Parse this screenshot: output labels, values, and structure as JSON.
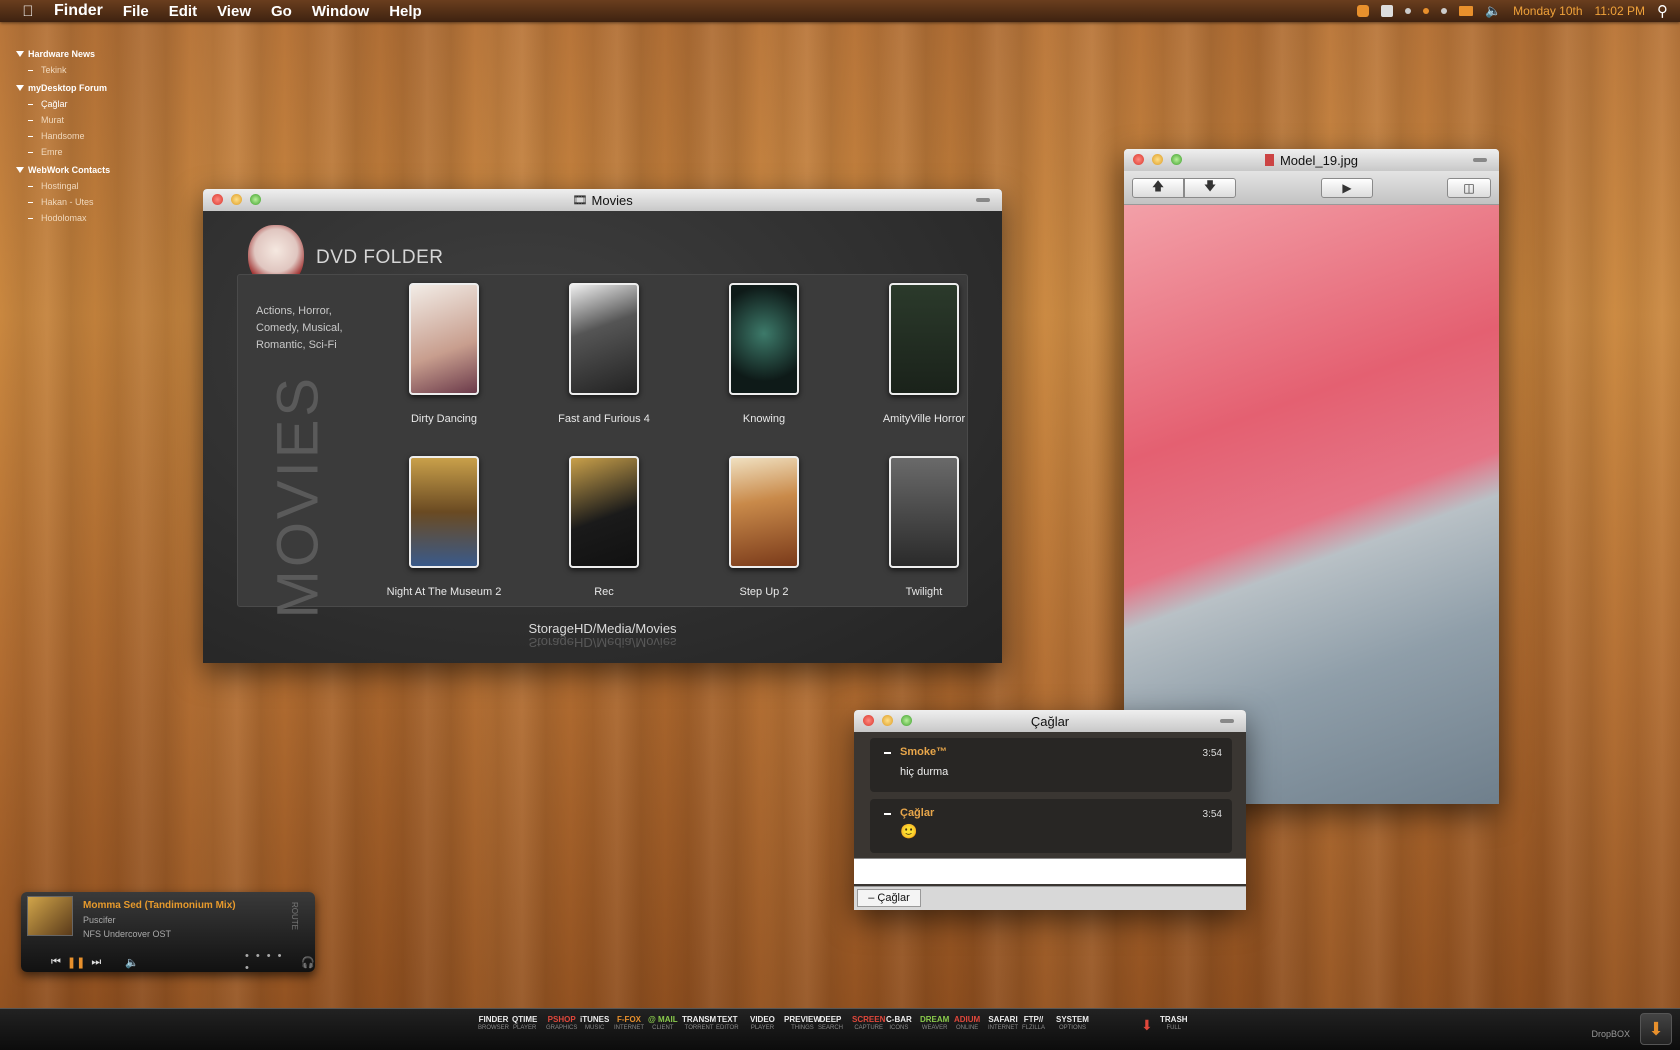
{
  "menubar": {
    "app": "Finder",
    "menus": [
      "File",
      "Edit",
      "View",
      "Go",
      "Window",
      "Help"
    ],
    "day": "Monday 10th",
    "time": "11:02 PM"
  },
  "sidebar": {
    "groups": [
      {
        "label": "Hardware News",
        "items": [
          "Tekink"
        ]
      },
      {
        "label": "myDesktop Forum",
        "items": [
          "Çağlar",
          "Murat",
          "Handsome",
          "Emre"
        ]
      },
      {
        "label": "WebWork Contacts",
        "items": [
          "Hostingal",
          "Hakan - Utes",
          "Hodolomax"
        ]
      }
    ]
  },
  "movies": {
    "title": "Movies",
    "header": "DVD FOLDER",
    "genres": "Actions, Horror, Comedy, Musical, Romantic, Sci-Fi",
    "side_word": "MOVIES",
    "path": "StorageHD/Media/Movies",
    "items": [
      {
        "title": "Dirty Dancing",
        "color": "#d9c7b8"
      },
      {
        "title": "Fast and Furious 4",
        "color": "#5a5a5a"
      },
      {
        "title": "Knowing",
        "color": "#234a3f"
      },
      {
        "title": "AmityVille Horror",
        "color": "#3d4a3a"
      },
      {
        "title": "Night At The Museum 2",
        "color": "#8a6a2a"
      },
      {
        "title": "Rec",
        "color": "#3a3020"
      },
      {
        "title": "Step Up 2",
        "color": "#b3743a"
      },
      {
        "title": "Twilight",
        "color": "#4a4a4a"
      }
    ]
  },
  "preview": {
    "title": "Model_19.jpg"
  },
  "chat": {
    "title": "Çağlar",
    "messages": [
      {
        "sender": "Smoke™",
        "time": "3:54",
        "text": "hiç durma"
      },
      {
        "sender": "Çağlar",
        "time": "3:54",
        "text": "🙂"
      }
    ],
    "tab": "– Çağlar"
  },
  "music": {
    "track": "Momma Sed (Tandimonium Mix)",
    "artist": "Puscifer",
    "album": "NFS Undercover OST",
    "route_label": "ROUTE"
  },
  "dock": {
    "items": [
      {
        "label": "FINDER",
        "sub": "BROWSER",
        "color": "white"
      },
      {
        "label": "QTIME",
        "sub": "PLAYER",
        "color": "white"
      },
      {
        "label": "PSHOP",
        "sub": "GRAPHICS",
        "color": "red"
      },
      {
        "label": "iTUNES",
        "sub": "MUSIC",
        "color": "white"
      },
      {
        "label": "F-FOX",
        "sub": "INTERNET",
        "color": "orange"
      },
      {
        "label": "@ MAIL",
        "sub": "CLIENT",
        "color": "green"
      },
      {
        "label": "TRANSM",
        "sub": "TORRENT",
        "color": "white"
      },
      {
        "label": "TEXT",
        "sub": "EDITOR",
        "color": "white"
      },
      {
        "label": "VIDEO",
        "sub": "PLAYER",
        "color": "white"
      },
      {
        "label": "PREVIEW",
        "sub": "THINGS",
        "color": "white"
      },
      {
        "label": "DEEP",
        "sub": "SEARCH",
        "color": "white"
      },
      {
        "label": "SCREEN",
        "sub": "CAPTURE",
        "color": "red"
      },
      {
        "label": "C-BAR",
        "sub": "ICONS",
        "color": "white"
      },
      {
        "label": "DREAM",
        "sub": "WEAVER",
        "color": "green"
      },
      {
        "label": "ADIUM",
        "sub": "ONLINE",
        "color": "red"
      },
      {
        "label": "SAFARI",
        "sub": "INTERNET",
        "color": "white"
      },
      {
        "label": "FTP//",
        "sub": "FLZILLA",
        "color": "white"
      },
      {
        "label": "SYSTEM",
        "sub": "OPTIONS",
        "color": "white"
      },
      {
        "label": "TRASH",
        "sub": "FULL",
        "color": "white"
      }
    ],
    "dropbox": "DropBOX"
  }
}
